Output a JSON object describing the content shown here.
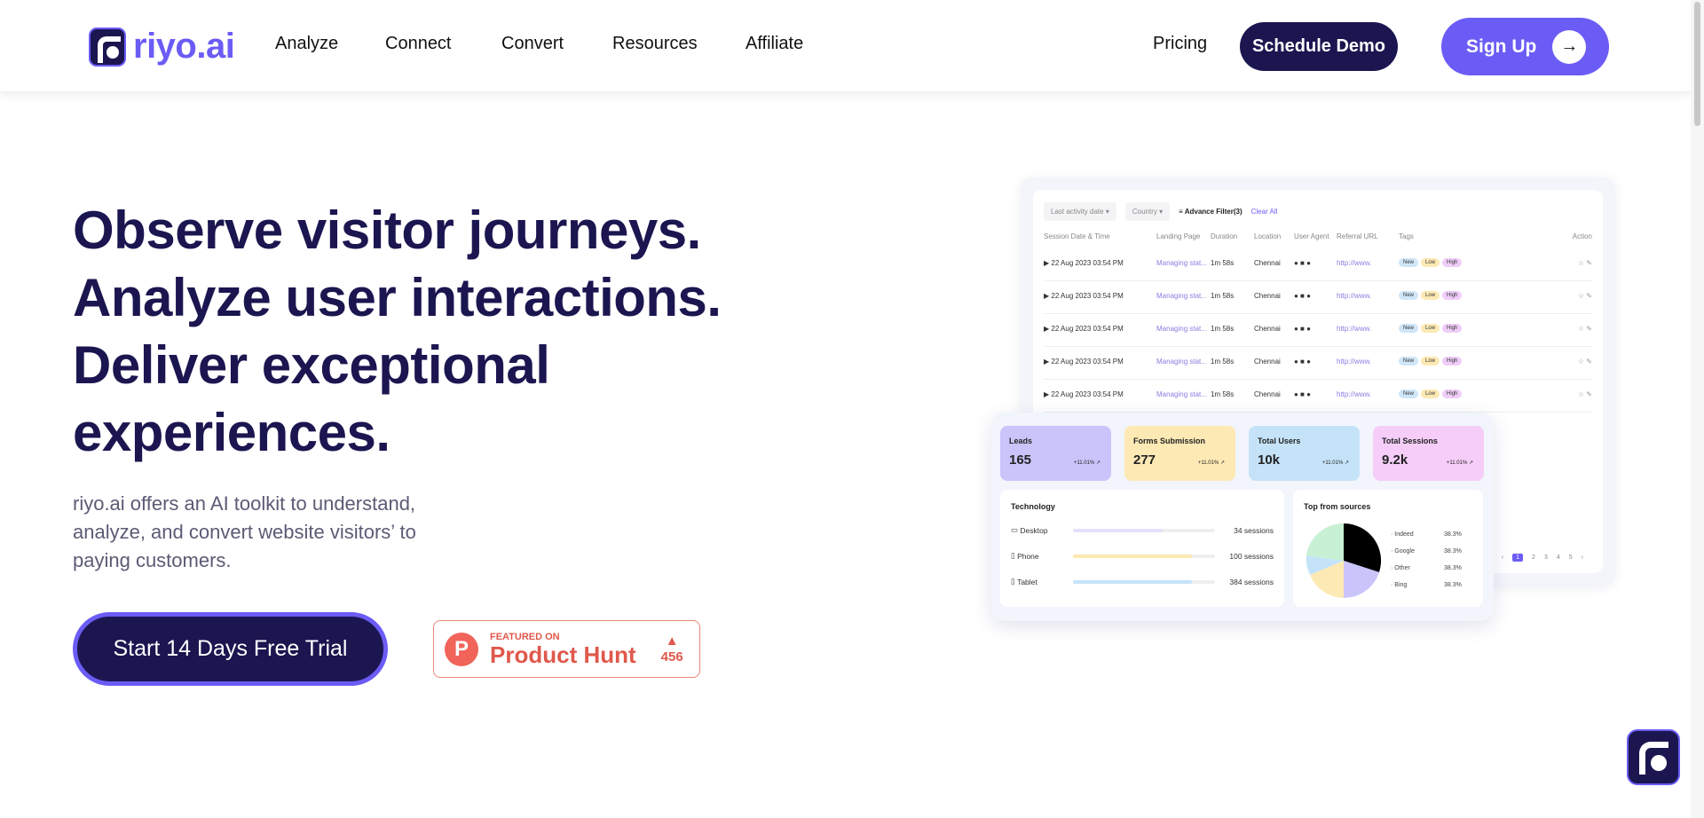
{
  "header": {
    "logo_text": "riyo.ai",
    "nav": [
      "Analyze",
      "Connect",
      "Convert",
      "Resources",
      "Affiliate"
    ],
    "pricing": "Pricing",
    "schedule_demo": "Schedule Demo",
    "sign_up": "Sign Up",
    "sign_up_icon": "arrow-right-icon"
  },
  "hero": {
    "headline": [
      "Observe visitor journeys.",
      "Analyze user interactions.",
      "Deliver exceptional",
      "experiences."
    ],
    "subtext": "riyo.ai offers an AI toolkit to understand, analyze, and convert website visitors’ to paying customers.",
    "cta": "Start 14 Days Free Trial"
  },
  "product_hunt": {
    "featured": "FEATURED ON",
    "name": "Product Hunt",
    "votes": "456",
    "color": "#e0584c"
  },
  "dashboard": {
    "filters": {
      "date": "Last activity date",
      "country": "Country",
      "advance": "Advance Filter(3)",
      "clear": "Clear All"
    },
    "columns": [
      "Session Date & Time",
      "Landing Page",
      "Duration",
      "Location",
      "User Agent",
      "Referral URL",
      "Tags",
      "Action"
    ],
    "rows": [
      {
        "date": "22 Aug 2023 03:54 PM",
        "page": "Managing stat...",
        "duration": "1m 58s",
        "location": "Chennai",
        "url": "http://www.",
        "tags": [
          "New",
          "Low",
          "High"
        ]
      },
      {
        "date": "22 Aug 2023 03:54 PM",
        "page": "Managing stat...",
        "duration": "1m 58s",
        "location": "Chennai",
        "url": "http://www.",
        "tags": [
          "New",
          "Low",
          "High"
        ]
      },
      {
        "date": "22 Aug 2023 03:54 PM",
        "page": "Managing stat...",
        "duration": "1m 58s",
        "location": "Chennai",
        "url": "http://www.",
        "tags": [
          "New",
          "Low",
          "High"
        ]
      },
      {
        "date": "22 Aug 2023 03:54 PM",
        "page": "Managing stat...",
        "duration": "1m 58s",
        "location": "Chennai",
        "url": "http://www.",
        "tags": [
          "New",
          "Low",
          "High"
        ]
      },
      {
        "date": "22 Aug 2023 03:54 PM",
        "page": "Managing stat...",
        "duration": "1m 58s",
        "location": "Chennai",
        "url": "http://www.",
        "tags": [
          "New",
          "Low",
          "High"
        ]
      }
    ],
    "pages": [
      "1",
      "2",
      "3",
      "4",
      "5"
    ],
    "stats": [
      {
        "label": "Leads",
        "value": "165",
        "change": "+11.01%",
        "color": "#c9c5fb"
      },
      {
        "label": "Forms Submission",
        "value": "277",
        "change": "+11.01%",
        "color": "#fde9b4"
      },
      {
        "label": "Total Users",
        "value": "10k",
        "change": "+11.01%",
        "color": "#c5e3f8"
      },
      {
        "label": "Total Sessions",
        "value": "9.2k",
        "change": "+11.01%",
        "color": "#f5cdf8"
      }
    ],
    "technology": {
      "title": "Technology",
      "items": [
        {
          "label": "Desktop",
          "sessions": "34 sessions",
          "fill": 0.63,
          "color": "#e4e0fb"
        },
        {
          "label": "Phone",
          "sessions": "100 sessions",
          "fill": 0.84,
          "color": "#fde9b4"
        },
        {
          "label": "Tablet",
          "sessions": "384 sessions",
          "fill": 0.84,
          "color": "#c5e3f8"
        }
      ]
    },
    "sources": {
      "title": "Top from sources",
      "items": [
        {
          "label": "Indeed",
          "pct": "38.3%"
        },
        {
          "label": "Google",
          "pct": "38.3%"
        },
        {
          "label": "Other",
          "pct": "38.3%"
        },
        {
          "label": "Bing",
          "pct": "38.3%"
        }
      ]
    }
  }
}
